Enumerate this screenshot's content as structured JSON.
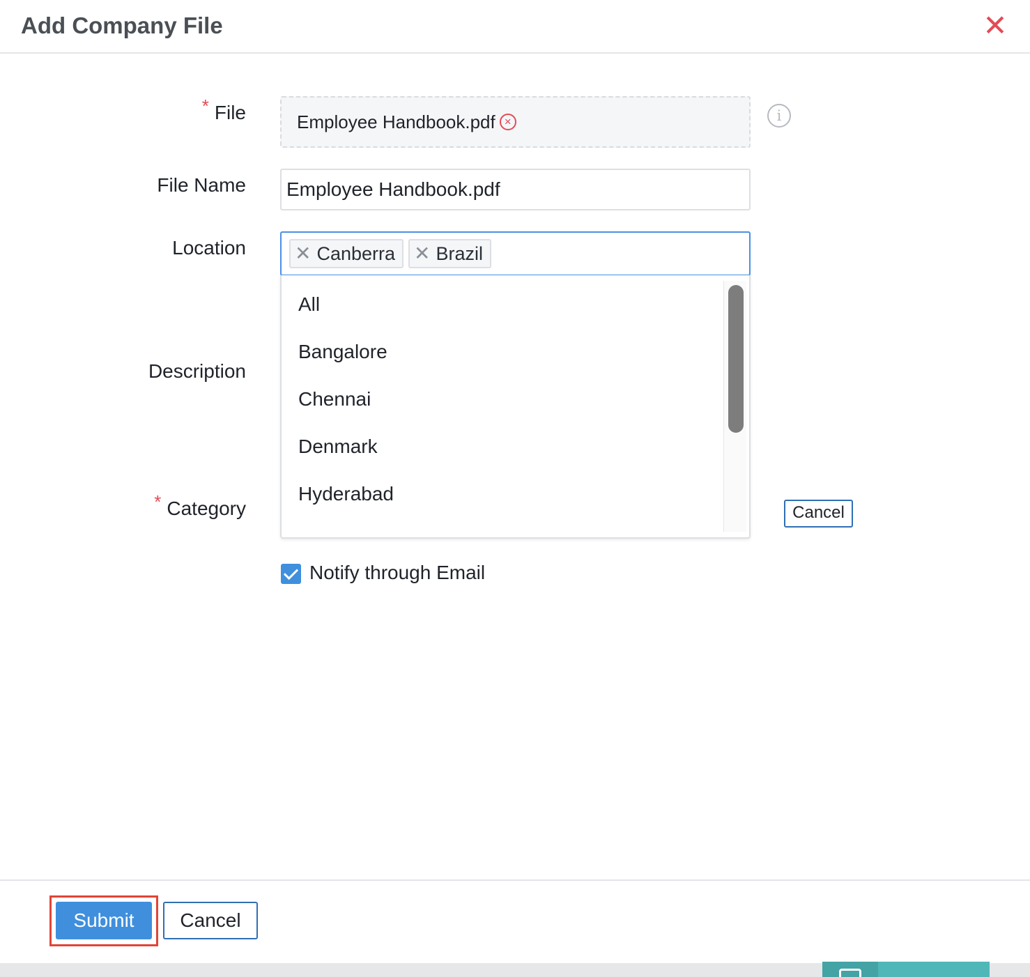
{
  "dialog": {
    "title": "Add Company File",
    "close_symbol": "✕"
  },
  "form": {
    "file": {
      "label": "File",
      "required_mark": "*",
      "uploaded_file": "Employee Handbook.pdf",
      "remove_symbol": "×"
    },
    "file_name": {
      "label": "File Name",
      "value": "Employee Handbook.pdf"
    },
    "location": {
      "label": "Location",
      "selected": [
        "Canberra",
        "Brazil"
      ],
      "remove_symbol": "✕",
      "options": [
        "All",
        "Bangalore",
        "Chennai",
        "Denmark",
        "Hyderabad"
      ]
    },
    "description": {
      "label": "Description"
    },
    "category": {
      "label": "Category",
      "required_mark": "*",
      "cancel_label": "Cancel"
    },
    "notify": {
      "label": "Notify through Email",
      "checked": true
    }
  },
  "footer": {
    "submit_label": "Submit",
    "cancel_label": "Cancel"
  },
  "colors": {
    "primary": "#3f8fdd",
    "required": "#e24b55",
    "highlight": "#e04535",
    "chat_widget": "#4fb7b8"
  },
  "icons": {
    "close": "close-icon",
    "info": "info-icon",
    "file_remove": "remove-circle-icon",
    "tag_remove": "x-icon",
    "checkbox": "checkmark-icon",
    "chat": "chat-icon"
  }
}
